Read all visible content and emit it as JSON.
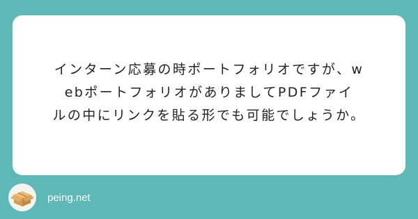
{
  "question": {
    "lines": [
      "インターン応募の時ポートフォリオですが、w",
      "ebポートフォリオがありましてPDFファイ",
      "ルの中にリンクを貼る形でも可能でしょうか。"
    ]
  },
  "footer": {
    "site_name": "peing.net",
    "logo_icon": "cardboard-box-icon"
  },
  "colors": {
    "background": "#5fb8b8",
    "card": "#ffffff",
    "text": "#222222",
    "box": "#d9a35b"
  }
}
